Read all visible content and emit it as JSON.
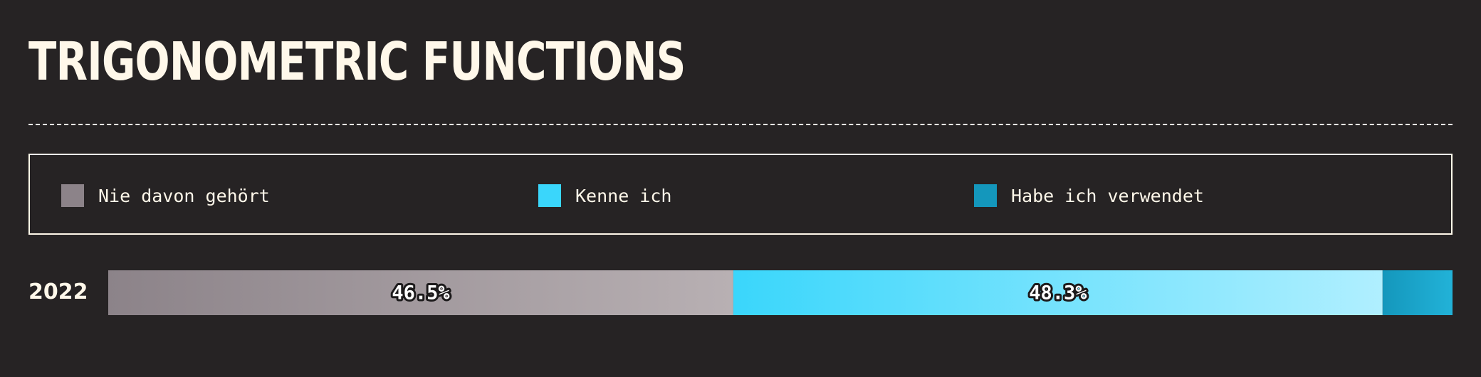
{
  "title": "TRIGONOMETRIC FUNCTIONS",
  "legend": [
    {
      "label": "Nie davon gehört",
      "color": "#8c8389"
    },
    {
      "label": "Kenne ich",
      "color": "#3ad6fb"
    },
    {
      "label": "Habe ich verwendet",
      "color": "#1497bc"
    }
  ],
  "chart_data": {
    "type": "bar",
    "orientation": "horizontal",
    "stacked": true,
    "normalized": true,
    "title": "TRIGONOMETRIC FUNCTIONS",
    "categories": [
      "2022"
    ],
    "series": [
      {
        "name": "Nie davon gehört",
        "values": [
          46.5
        ],
        "value_labels": [
          "46.5%"
        ],
        "color": "#8c8389",
        "color_end": "#b8b0b3"
      },
      {
        "name": "Kenne ich",
        "values": [
          48.3
        ],
        "value_labels": [
          "48.3%"
        ],
        "color": "#3ad6fb",
        "color_end": "#b0efff"
      },
      {
        "name": "Habe ich verwendet",
        "values": [
          5.2
        ],
        "value_labels": [
          ""
        ],
        "color": "#1497bc",
        "color_end": "#22b2d8"
      }
    ],
    "xlim": [
      0,
      100
    ],
    "legend_position": "top"
  }
}
